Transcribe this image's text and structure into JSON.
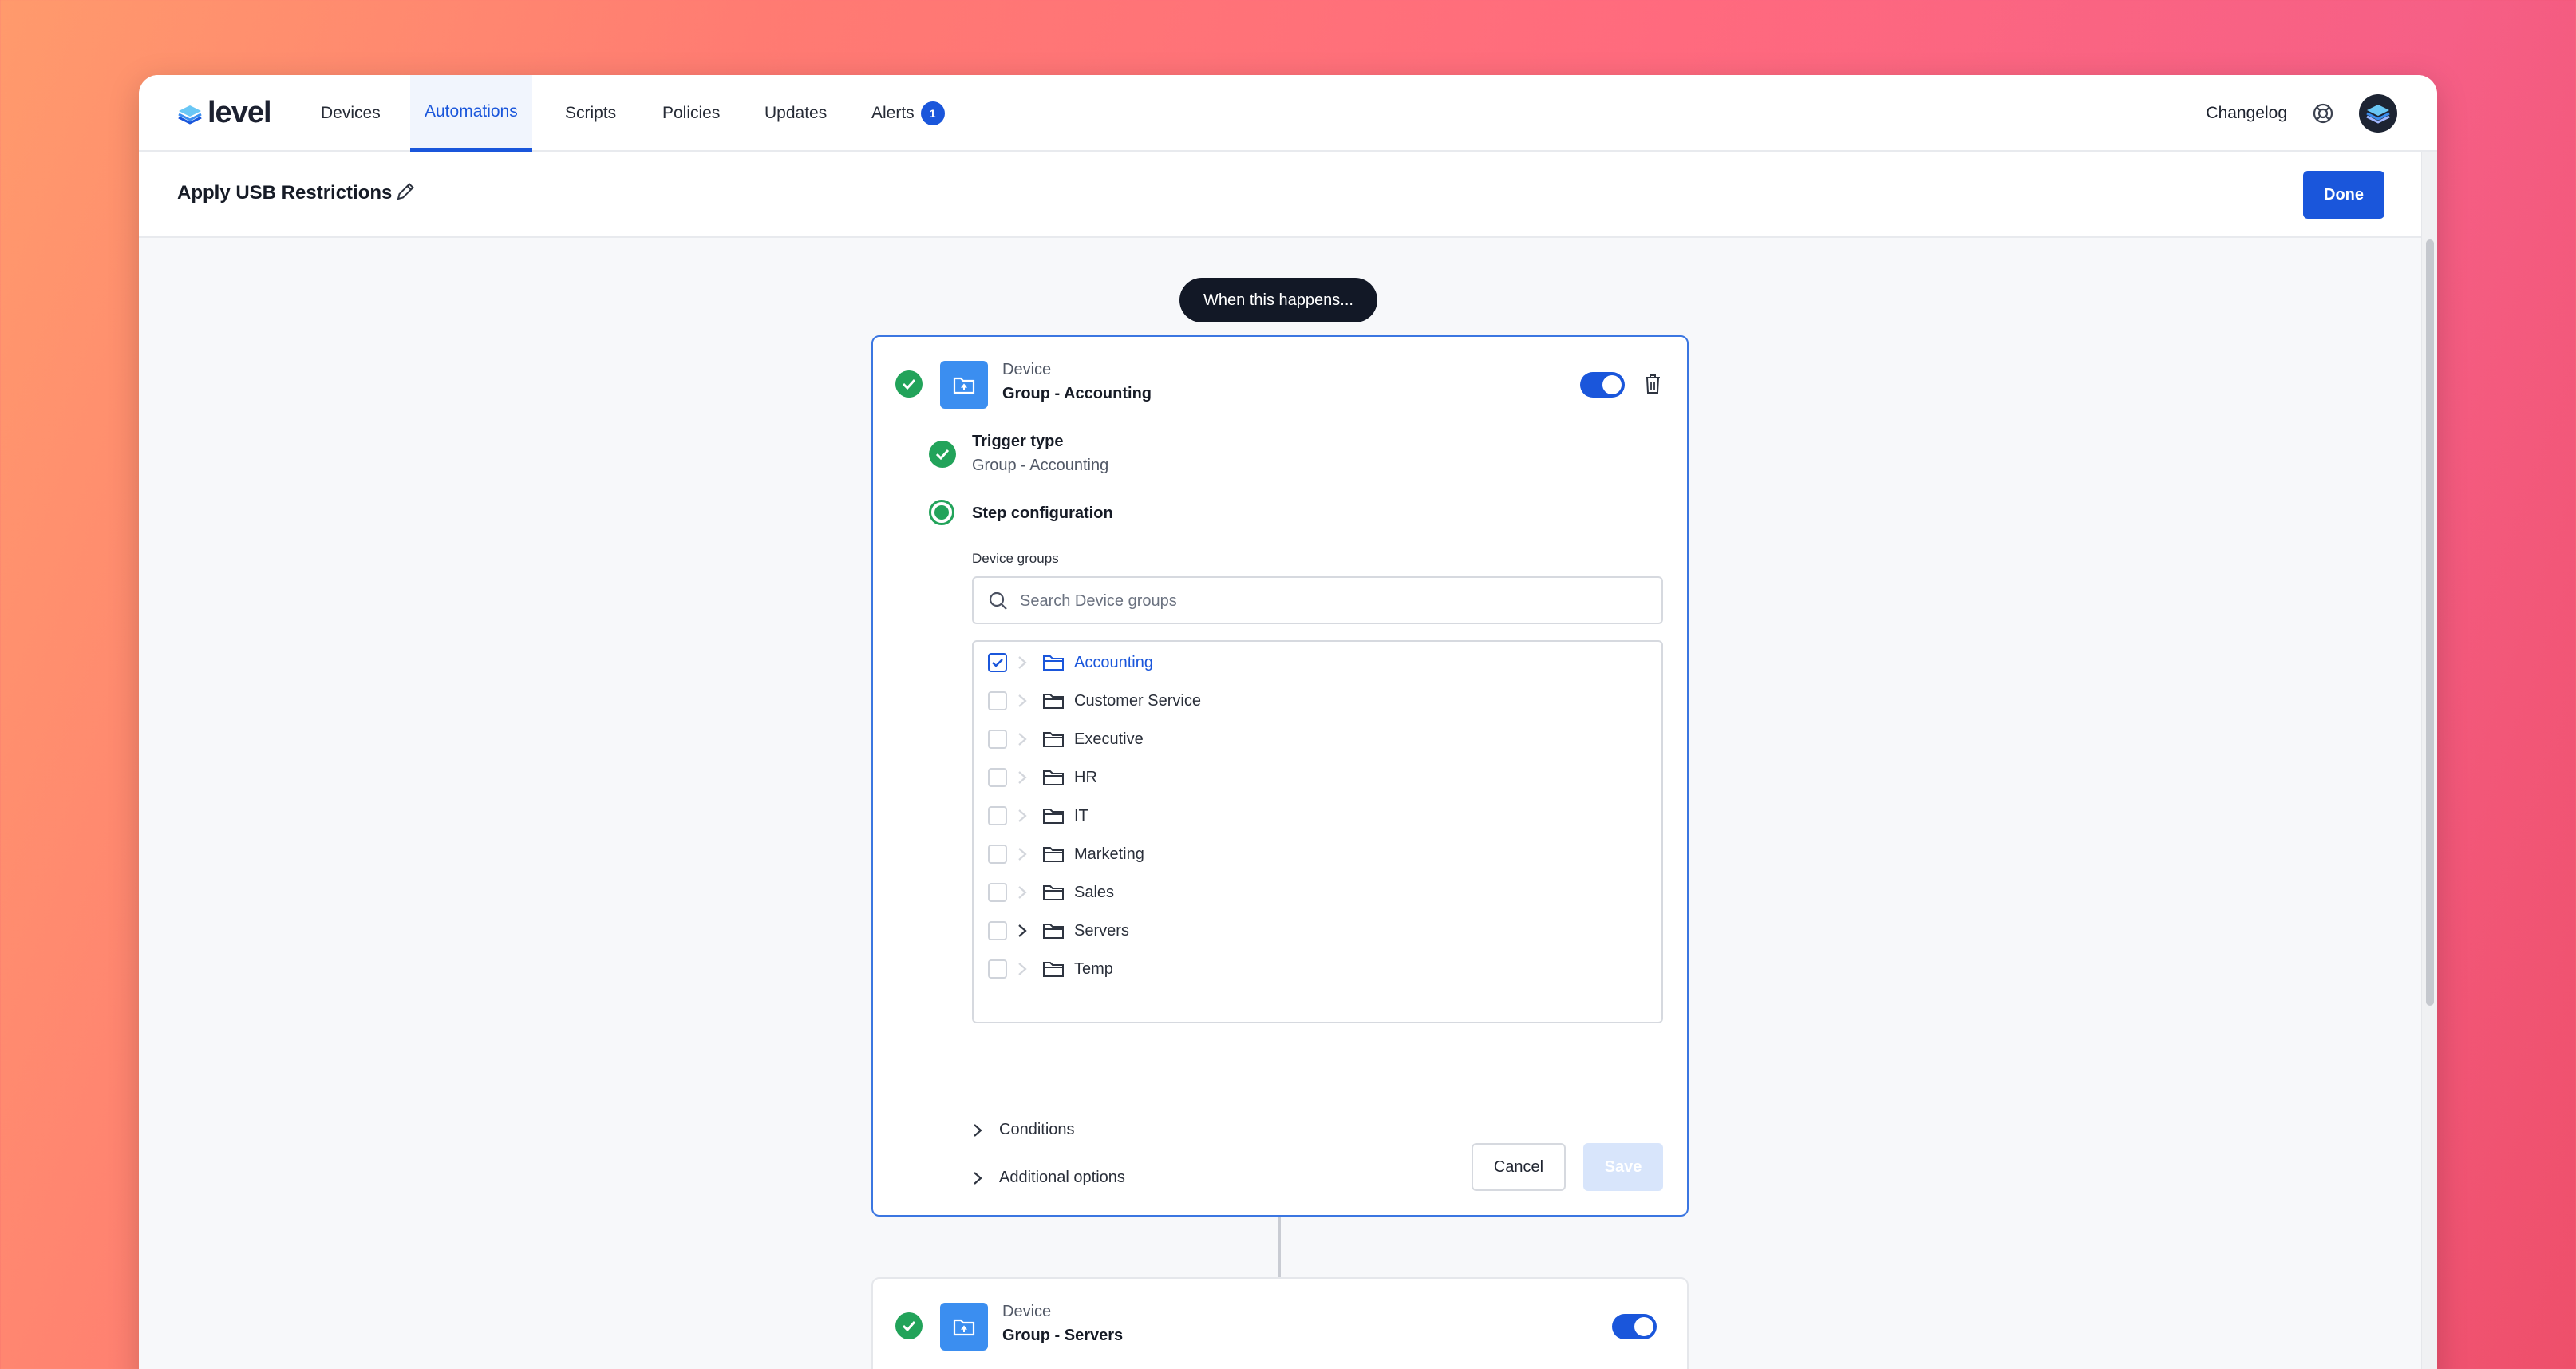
{
  "app": {
    "logo_text": "level"
  },
  "nav": {
    "items": [
      {
        "label": "Devices"
      },
      {
        "label": "Automations"
      },
      {
        "label": "Scripts"
      },
      {
        "label": "Policies"
      },
      {
        "label": "Updates"
      },
      {
        "label": "Alerts"
      }
    ],
    "active": "Automations",
    "alerts_count": "1",
    "changelog": "Changelog",
    "help_icon": "lifebuoy-icon",
    "avatar_icon": "layers-logo-icon"
  },
  "header": {
    "title": "Apply USB Restrictions",
    "edit_icon": "pencil-icon",
    "done_label": "Done"
  },
  "flow": {
    "trigger_pill": "When this happens...",
    "step1": {
      "kind": "Device",
      "name": "Group - Accounting",
      "enabled": true,
      "trigger_type_label": "Trigger type",
      "trigger_type_value": "Group - Accounting",
      "step_config_label": "Step configuration",
      "device_groups_label": "Device groups",
      "search_placeholder": "Search Device groups",
      "groups": [
        {
          "label": "Accounting",
          "checked": true,
          "expandable": false
        },
        {
          "label": "Customer Service",
          "checked": false,
          "expandable": false
        },
        {
          "label": "Executive",
          "checked": false,
          "expandable": false
        },
        {
          "label": "HR",
          "checked": false,
          "expandable": false
        },
        {
          "label": "IT",
          "checked": false,
          "expandable": false
        },
        {
          "label": "Marketing",
          "checked": false,
          "expandable": false
        },
        {
          "label": "Sales",
          "checked": false,
          "expandable": false
        },
        {
          "label": "Servers",
          "checked": false,
          "expandable": true
        },
        {
          "label": "Temp",
          "checked": false,
          "expandable": false
        }
      ],
      "conditions_label": "Conditions",
      "additional_options_label": "Additional options",
      "cancel_label": "Cancel",
      "save_label": "Save"
    },
    "step2": {
      "kind": "Device",
      "name": "Group - Servers",
      "enabled": true
    }
  },
  "colors": {
    "accent": "#1a56db",
    "success": "#22a35a",
    "tile": "#3b8ef0"
  }
}
